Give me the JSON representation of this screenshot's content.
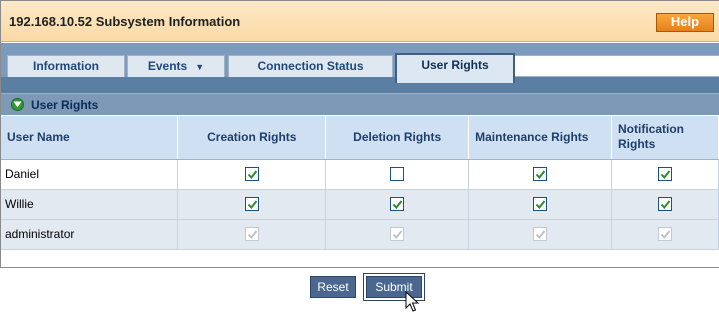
{
  "window": {
    "title": "192.168.10.52 Subsystem Information",
    "help_label": "Help"
  },
  "tabs": [
    {
      "label": "Information",
      "active": false
    },
    {
      "label": "Events",
      "active": false,
      "has_dropdown": true
    },
    {
      "label": "Connection Status",
      "active": false
    },
    {
      "label": "User Rights",
      "active": true
    }
  ],
  "section": {
    "title": "User Rights",
    "icon": "collapse-down-icon"
  },
  "table": {
    "columns": [
      "User Name",
      "Creation Rights",
      "Deletion Rights",
      "Maintenance Rights",
      "Notification Rights"
    ],
    "rows": [
      {
        "user": "Daniel",
        "creation": true,
        "deletion": false,
        "maintenance": true,
        "notification": true,
        "disabled": false
      },
      {
        "user": "Willie",
        "creation": true,
        "deletion": true,
        "maintenance": true,
        "notification": true,
        "disabled": false
      },
      {
        "user": "administrator",
        "creation": true,
        "deletion": true,
        "maintenance": true,
        "notification": true,
        "disabled": true
      }
    ]
  },
  "actions": {
    "reset_label": "Reset",
    "submit_label": "Submit"
  },
  "colors": {
    "title_bar": "#fbd9a4",
    "help_button": "#f08c20",
    "tab_strip": "#7c9abb",
    "header_bg": "#cfe0f3",
    "button_bg": "#4b6790"
  }
}
